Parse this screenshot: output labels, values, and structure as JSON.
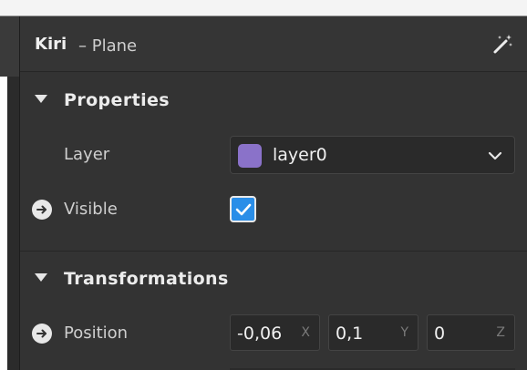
{
  "header": {
    "object_name": "Kiri",
    "object_kind": "– Plane",
    "magic_icon": "magic-wand-icon"
  },
  "properties": {
    "title": "Properties",
    "layer_label": "Layer",
    "layer_value": "layer0",
    "layer_color": "#8a72c9",
    "visible_label": "Visible",
    "visible_checked": true,
    "checkbox_color": "#2a8ee8"
  },
  "transformations": {
    "title": "Transformations",
    "position_label": "Position",
    "position": {
      "x": "-0,06",
      "x_axis": "X",
      "y": "0,1",
      "y_axis": "Y",
      "z": "0",
      "z_axis": "Z"
    }
  }
}
